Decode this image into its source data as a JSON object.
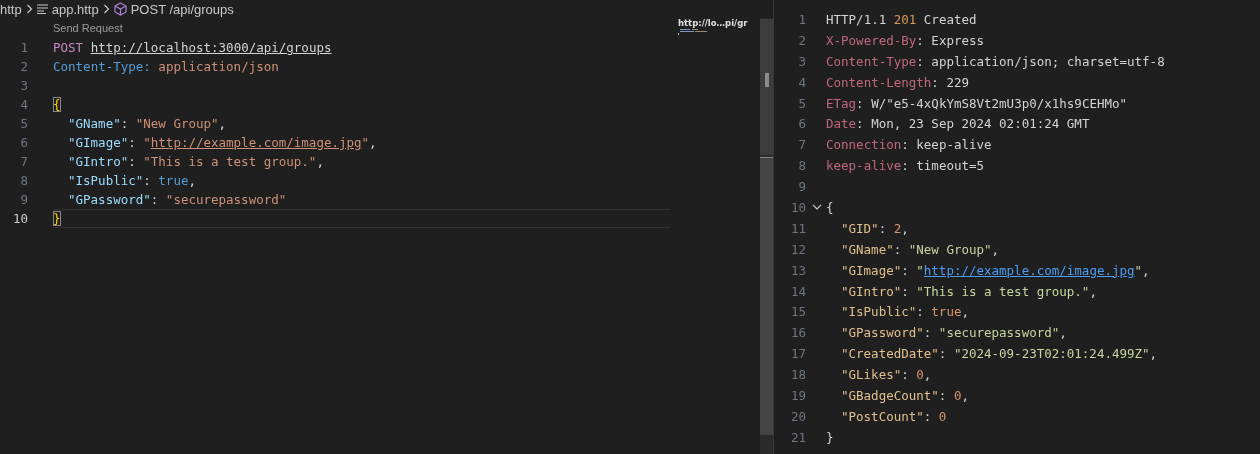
{
  "breadcrumb": [
    {
      "kind": "folder",
      "text": "http"
    },
    {
      "kind": "file",
      "text": "app.http"
    },
    {
      "kind": "request",
      "text": "POST /api/groups"
    }
  ],
  "request_editor": {
    "codelens": "Send Request",
    "minimap_title": "http://lo…pi/gr",
    "lines": [
      {
        "number": "1",
        "current": false,
        "tokens": [
          {
            "kind": "method",
            "text": "POST "
          },
          {
            "kind": "url",
            "text": "http://localhost:3000/api/groups"
          }
        ]
      },
      {
        "number": "2",
        "current": false,
        "tokens": [
          {
            "kind": "header-name",
            "text": "Content-Type: "
          },
          {
            "kind": "header-value",
            "text": "application/json"
          }
        ]
      },
      {
        "number": "3",
        "current": false
      },
      {
        "number": "4",
        "current": false,
        "tokens": [
          {
            "kind": "brace",
            "text": "{"
          }
        ],
        "children": [
          {
            "number": "5",
            "current": false,
            "tokens": [
              {
                "kind": "key",
                "text": "\"GName\""
              },
              {
                "kind": "plain",
                "text": ": "
              },
              {
                "kind": "string",
                "text": "\"New Group\""
              },
              {
                "kind": "plain",
                "text": ","
              }
            ]
          },
          {
            "number": "6",
            "current": false,
            "tokens": [
              {
                "kind": "key",
                "text": "\"GImage\""
              },
              {
                "kind": "plain",
                "text": ": "
              },
              {
                "kind": "string",
                "text": "\""
              },
              {
                "kind": "string-link",
                "text": "http://example.com/image.jpg"
              },
              {
                "kind": "string",
                "text": "\""
              },
              {
                "kind": "plain",
                "text": ","
              }
            ]
          },
          {
            "number": "7",
            "current": false,
            "tokens": [
              {
                "kind": "key",
                "text": "\"GIntro\""
              },
              {
                "kind": "plain",
                "text": ": "
              },
              {
                "kind": "string",
                "text": "\"This is a test group.\""
              },
              {
                "kind": "plain",
                "text": ","
              }
            ]
          },
          {
            "number": "8",
            "current": false,
            "tokens": [
              {
                "kind": "key",
                "text": "\"IsPublic\""
              },
              {
                "kind": "plain",
                "text": ": "
              },
              {
                "kind": "bool",
                "text": "true"
              },
              {
                "kind": "plain",
                "text": ","
              }
            ]
          },
          {
            "number": "9",
            "current": false,
            "tokens": [
              {
                "kind": "key",
                "text": "\"GPassword\""
              },
              {
                "kind": "plain",
                "text": ": "
              },
              {
                "kind": "string",
                "text": "\"securepassword\""
              }
            ]
          }
        ]
      },
      {
        "number": "10",
        "current": true,
        "tokens": [
          {
            "kind": "brace",
            "text": "}"
          }
        ]
      }
    ]
  },
  "response_editor": {
    "lines": [
      {
        "number": "1",
        "kind": "plain",
        "tokens": [
          {
            "kind": "plain",
            "text": "HTTP/1.1 "
          },
          {
            "kind": "status",
            "text": "201"
          },
          {
            "kind": "plain",
            "text": " Created"
          }
        ]
      },
      {
        "number": "2",
        "kind": "plain",
        "tokens": [
          {
            "kind": "res-header",
            "text": "X-Powered-By"
          },
          {
            "kind": "plain",
            "text": ": Express"
          }
        ]
      },
      {
        "number": "3",
        "kind": "plain",
        "tokens": [
          {
            "kind": "res-header",
            "text": "Content-Type"
          },
          {
            "kind": "plain",
            "text": ": application/json; charset=utf-8"
          }
        ]
      },
      {
        "number": "4",
        "kind": "plain",
        "tokens": [
          {
            "kind": "res-header",
            "text": "Content-Length"
          },
          {
            "kind": "plain",
            "text": ": 229"
          }
        ]
      },
      {
        "number": "5",
        "kind": "plain",
        "tokens": [
          {
            "kind": "res-header",
            "text": "ETag"
          },
          {
            "kind": "plain",
            "text": ": W/\"e5-4xQkYmS8Vt2mU3p0/x1hs9CEHMo\""
          }
        ]
      },
      {
        "number": "6",
        "kind": "plain",
        "tokens": [
          {
            "kind": "res-header",
            "text": "Date"
          },
          {
            "kind": "plain",
            "text": ": Mon, 23 Sep 2024 02:01:24 GMT"
          }
        ]
      },
      {
        "number": "7",
        "kind": "plain",
        "tokens": [
          {
            "kind": "res-header",
            "text": "Connection"
          },
          {
            "kind": "plain",
            "text": ": keep-alive"
          }
        ]
      },
      {
        "number": "8",
        "kind": "plain",
        "tokens": [
          {
            "kind": "res-header",
            "text": "keep-alive"
          },
          {
            "kind": "plain",
            "text": ": timeout=5"
          }
        ]
      },
      {
        "number": "9",
        "kind": "plain"
      },
      {
        "number": "10",
        "kind": "fold",
        "tokens": [
          {
            "kind": "plain",
            "text": "{"
          }
        ],
        "children": [
          {
            "number": "11",
            "kind": "plain",
            "tokens": [
              {
                "kind": "res-key",
                "text": "\"GID\""
              },
              {
                "kind": "plain",
                "text": ": "
              },
              {
                "kind": "number",
                "text": "2"
              },
              {
                "kind": "plain",
                "text": ","
              }
            ]
          },
          {
            "number": "12",
            "kind": "plain",
            "tokens": [
              {
                "kind": "res-key",
                "text": "\"GName\""
              },
              {
                "kind": "plain",
                "text": ": "
              },
              {
                "kind": "res-string",
                "text": "\"New Group\""
              },
              {
                "kind": "plain",
                "text": ","
              }
            ]
          },
          {
            "number": "13",
            "kind": "plain",
            "tokens": [
              {
                "kind": "res-key",
                "text": "\"GImage\""
              },
              {
                "kind": "plain",
                "text": ": "
              },
              {
                "kind": "res-string",
                "text": "\""
              },
              {
                "kind": "link",
                "text": "http://example.com/image.jpg"
              },
              {
                "kind": "res-string",
                "text": "\""
              },
              {
                "kind": "plain",
                "text": ","
              }
            ]
          },
          {
            "number": "14",
            "kind": "plain",
            "tokens": [
              {
                "kind": "res-key",
                "text": "\"GIntro\""
              },
              {
                "kind": "plain",
                "text": ": "
              },
              {
                "kind": "res-string",
                "text": "\"This is a test group.\""
              },
              {
                "kind": "plain",
                "text": ","
              }
            ]
          },
          {
            "number": "15",
            "kind": "plain",
            "tokens": [
              {
                "kind": "res-key",
                "text": "\"IsPublic\""
              },
              {
                "kind": "plain",
                "text": ": "
              },
              {
                "kind": "number",
                "text": "true"
              },
              {
                "kind": "plain",
                "text": ","
              }
            ]
          },
          {
            "number": "16",
            "kind": "plain",
            "tokens": [
              {
                "kind": "res-key",
                "text": "\"GPassword\""
              },
              {
                "kind": "plain",
                "text": ": "
              },
              {
                "kind": "res-string",
                "text": "\"securepassword\""
              },
              {
                "kind": "plain",
                "text": ","
              }
            ]
          },
          {
            "number": "17",
            "kind": "plain",
            "tokens": [
              {
                "kind": "res-key",
                "text": "\"CreatedDate\""
              },
              {
                "kind": "plain",
                "text": ": "
              },
              {
                "kind": "res-string",
                "text": "\"2024-09-23T02:01:24.499Z\""
              },
              {
                "kind": "plain",
                "text": ","
              }
            ]
          },
          {
            "number": "18",
            "kind": "plain",
            "tokens": [
              {
                "kind": "res-key",
                "text": "\"GLikes\""
              },
              {
                "kind": "plain",
                "text": ": "
              },
              {
                "kind": "number",
                "text": "0"
              },
              {
                "kind": "plain",
                "text": ","
              }
            ]
          },
          {
            "number": "19",
            "kind": "plain",
            "tokens": [
              {
                "kind": "res-key",
                "text": "\"GBadgeCount\""
              },
              {
                "kind": "plain",
                "text": ": "
              },
              {
                "kind": "number",
                "text": "0"
              },
              {
                "kind": "plain",
                "text": ","
              }
            ]
          },
          {
            "number": "20",
            "kind": "plain",
            "tokens": [
              {
                "kind": "res-key",
                "text": "\"PostCount\""
              },
              {
                "kind": "plain",
                "text": ": "
              },
              {
                "kind": "number",
                "text": "0"
              }
            ]
          }
        ]
      },
      {
        "number": "21",
        "kind": "plain",
        "tokens": [
          {
            "kind": "plain",
            "text": "}"
          }
        ]
      }
    ]
  }
}
